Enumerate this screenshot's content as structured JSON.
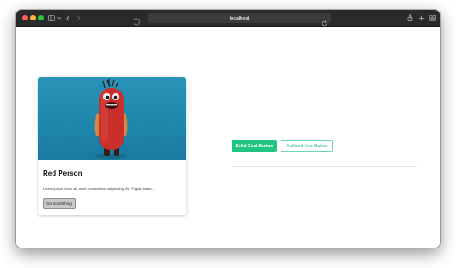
{
  "browser": {
    "url": "localhost",
    "traffic_lights": [
      "close",
      "minimize",
      "zoom"
    ],
    "icons": {
      "sidebar": "sidebar-icon",
      "tab_dropdown": "chevron-down-icon",
      "back": "chevron-left-icon",
      "forward": "chevron-right-icon",
      "privacy": "shield-icon",
      "reload": "reload-icon",
      "share": "share-icon",
      "new_tab": "plus-icon",
      "tab_overview": "grid-icon"
    }
  },
  "card": {
    "title": "Red Person",
    "text": "Lorem ipsum dolor sit, amet consectetur adipisicing elit. Fugiat, totam...",
    "button_label": "Do Something",
    "image_subject": "red-monster-figurine"
  },
  "buttons": {
    "solid_label": "Solid Cool Button",
    "outlined_label": "Outlined Cool Button"
  },
  "colors": {
    "accent": "#22c484",
    "image_background": "#2a93b8",
    "monster_red": "#c9302c"
  }
}
